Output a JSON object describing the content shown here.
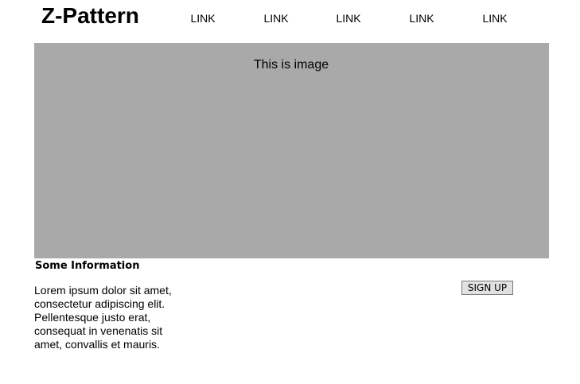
{
  "header": {
    "title": "Z-Pattern",
    "nav": [
      {
        "label": "LINK"
      },
      {
        "label": "LINK"
      },
      {
        "label": "LINK"
      },
      {
        "label": "LINK"
      },
      {
        "label": "LINK"
      }
    ]
  },
  "hero": {
    "caption": "This is image",
    "background_color": "#a9a9a9"
  },
  "info": {
    "heading": "Some Information",
    "body": "Lorem ipsum dolor sit amet, consectetur adipiscing elit. Pellentesque justo erat, consequat in venenatis sit amet, convallis et mauris."
  },
  "cta": {
    "signup_label": "SIGN UP"
  }
}
